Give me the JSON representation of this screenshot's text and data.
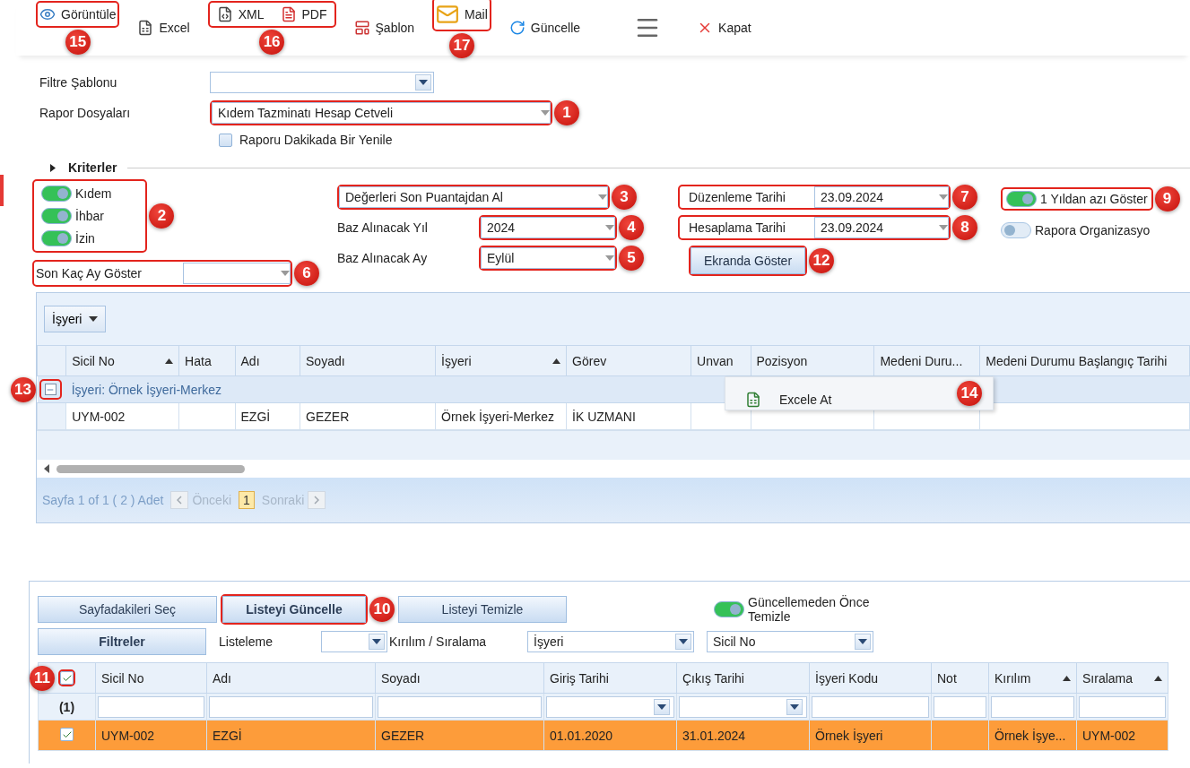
{
  "toolbar": {
    "items": [
      {
        "kind": "button",
        "label": "Görüntüle",
        "callout": "15"
      },
      {
        "kind": "button",
        "label": "Excel"
      },
      {
        "kind": "group",
        "callout": "16",
        "items": [
          {
            "label": "XML"
          },
          {
            "label": "PDF"
          }
        ]
      },
      {
        "kind": "button",
        "label": "Şablon"
      },
      {
        "kind": "button",
        "label": "Mail",
        "callout": "17"
      },
      {
        "kind": "button",
        "label": "Güncelle"
      },
      {
        "kind": "menu"
      },
      {
        "kind": "button",
        "label": "Kapat"
      }
    ]
  },
  "form": {
    "filter_template": {
      "label": "Filtre Şablonu"
    },
    "report_files": {
      "label": "Rapor Dosyaları",
      "value": "Kıdem Tazminatı Hesap Cetveli",
      "callout": "1"
    },
    "auto_refresh": {
      "label": "Raporu Dakikada Bir Yenile",
      "checked": false
    }
  },
  "criteria": {
    "title": "Kriterler",
    "toggle_group": {
      "callout": "2",
      "items": [
        {
          "label": "Kıdem",
          "on": true
        },
        {
          "label": "İhbar",
          "on": true
        },
        {
          "label": "İzin",
          "on": true
        }
      ]
    },
    "months": {
      "label": "Son Kaç Ay Göster",
      "callout": "6"
    },
    "source": {
      "value": "Değerleri Son Puantajdan Al",
      "callout": "3"
    },
    "fields": [
      {
        "label": "Baz Alınacak Yıl",
        "value": "2024",
        "callout": "4"
      },
      {
        "label": "Baz Alınacak Ay",
        "value": "Eylül",
        "callout": "5"
      }
    ],
    "dates": [
      {
        "label": "Düzenleme Tarihi",
        "value": "23.09.2024",
        "callout": "7"
      },
      {
        "label": "Hesaplama Tarihi",
        "value": "23.09.2024",
        "callout": "8"
      }
    ],
    "show_button": {
      "label": "Ekranda Göster",
      "callout": "12"
    },
    "options": [
      {
        "label": "1 Yıldan azı Göster",
        "on": true,
        "callout": "9"
      },
      {
        "label": "Rapora Organizasyo",
        "on": false
      }
    ]
  },
  "grid": {
    "group_by": {
      "label": "İşyeri"
    },
    "columns": [
      {
        "label": "Sicil No",
        "sorted": true
      },
      {
        "label": "Hata",
        "sorted": false
      },
      {
        "label": "Adı",
        "sorted": false
      },
      {
        "label": "Soyadı",
        "sorted": false
      },
      {
        "label": "İşyeri",
        "sorted": true
      },
      {
        "label": "Görev",
        "sorted": false
      },
      {
        "label": "Unvan",
        "sorted": false
      },
      {
        "label": "Pozisyon",
        "sorted": false
      },
      {
        "label": "Medeni Duru...",
        "sorted": false
      },
      {
        "label": "Medeni Durumu Başlangıç Tarihi",
        "sorted": false
      }
    ],
    "groups": [
      {
        "label": "İşyeri: Örnek İşyeri-Merkez",
        "expanded": true,
        "callout": "13",
        "rows": [
          [
            "UYM-002",
            null,
            "EZGİ",
            "GEZER",
            "Örnek İşyeri-Merkez",
            "İK UZMANI",
            null,
            null,
            null,
            null
          ]
        ]
      }
    ],
    "context_menu": {
      "callout": "14",
      "items": [
        {
          "label": "Excele At"
        }
      ]
    },
    "pager": {
      "summary": "Sayfa 1 of 1 ( 2 ) Adet",
      "prev": {
        "label": "Önceki",
        "disabled": true
      },
      "page": "1",
      "next": {
        "label": "Sonraki",
        "disabled": true
      }
    }
  },
  "selection": {
    "buttons": [
      {
        "label": "Sayfadakileri Seç",
        "primary": false
      },
      {
        "label": "Listeyi Güncelle",
        "primary": true,
        "callout": "10"
      },
      {
        "label": "Listeyi Temizle",
        "primary": false
      }
    ],
    "clear_toggle": {
      "label": "Güncellemeden Önce Temizle",
      "on": true
    },
    "filters_button": "Filtreler",
    "listing": {
      "label": "Listeleme"
    },
    "break_label": "Kırılım / Sıralama",
    "break_value": "İşyeri",
    "sort_value": "Sicil No",
    "table": {
      "all_checked": true,
      "callout": "11",
      "columns": [
        {
          "label": "Sicil No",
          "sorted": false
        },
        {
          "label": "Adı",
          "sorted": false
        },
        {
          "label": "Soyadı",
          "sorted": false
        },
        {
          "label": "Giriş Tarihi",
          "sorted": false
        },
        {
          "label": "Çıkış Tarihi",
          "sorted": false
        },
        {
          "label": "İşyeri Kodu",
          "sorted": false
        },
        {
          "label": "Not",
          "sorted": false
        },
        {
          "label": "Kırılım",
          "sorted": true
        },
        {
          "label": "Sıralama",
          "sorted": true
        }
      ],
      "filter_row": {
        "count": "(1)",
        "dropdowns": [
          false,
          false,
          false,
          true,
          true,
          false,
          false,
          false,
          false
        ]
      },
      "rows": [
        {
          "checked": true,
          "selected": true,
          "cells": [
            "UYM-002",
            "EZGİ",
            "GEZER",
            "01.01.2020",
            "31.01.2024",
            "Örnek İşyeri",
            null,
            "Örnek İşye...",
            "UYM-002"
          ]
        }
      ]
    }
  }
}
